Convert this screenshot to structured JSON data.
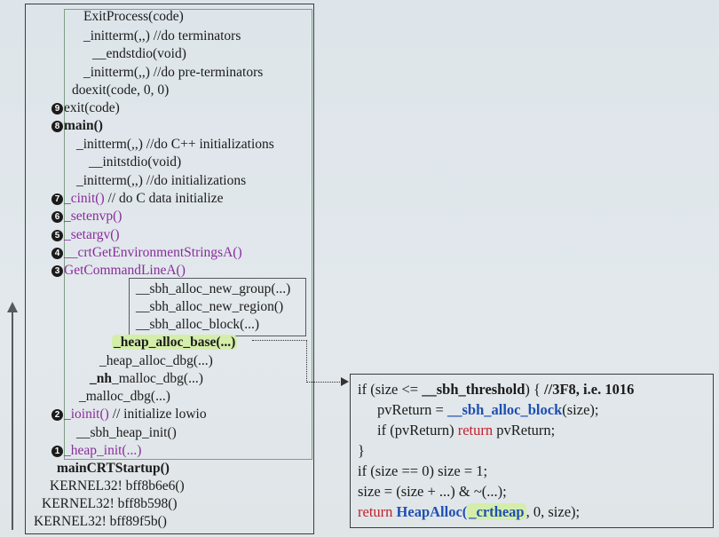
{
  "call_stack": {
    "exit_process": "ExitProcess(code)",
    "initterm_terminators": "_initterm(,,)   //do terminators",
    "endstdio": "__endstdio(void)",
    "initterm_preterminators": "_initterm(,,)   //do pre-terminators",
    "doexit": "doexit(code, 0, 0)",
    "exit": "exit(code)",
    "main": "main()",
    "initterm_cpp": "_initterm(,,)   //do C++ initializations",
    "initstdio": "__initstdio(void)",
    "initterm_init": "_initterm(,,)   //do initializations",
    "cinit_fn": "_cinit()",
    "cinit_comment": "// do C data initialize",
    "setenvp": "_setenvp()",
    "setargv": "_setargv()",
    "crt_get_env": "__crtGetEnvironmentStringsA()",
    "get_cmdline": "GetCommandLineA()",
    "sbh_new_group": "__sbh_alloc_new_group(...)",
    "sbh_new_region": "__sbh_alloc_new_region()",
    "sbh_alloc_block": "__sbh_alloc_block(...)",
    "heap_alloc_base": "_heap_alloc_base(...)",
    "heap_alloc_dbg": "_heap_alloc_dbg(...)",
    "nh_malloc_dbg_prefix": "_nh",
    "nh_malloc_dbg_rest": "_malloc_dbg(...)",
    "malloc_dbg": "_malloc_dbg(...)",
    "ioinit_fn": "_ioinit()",
    "ioinit_comment": "// initialize lowio",
    "sbh_heap_init": "__sbh_heap_init()",
    "heap_init": "_heap_init(...)",
    "main_crt_startup": "mainCRTStartup()",
    "kernel1": "KERNEL32! bff8b6e6()",
    "kernel2": "KERNEL32! bff8b598()",
    "kernel3": "KERNEL32! bff89f5b()"
  },
  "step_numbers": [
    "1",
    "2",
    "3",
    "4",
    "5",
    "6",
    "7",
    "8",
    "9"
  ],
  "code_snippet": {
    "l1_a": "if (size <= ",
    "l1_b": "__sbh_threshold",
    "l1_c": ") {    ",
    "l1_d": "//3F8, i.e. 1016",
    "l2_a": "pvReturn = ",
    "l2_b": "__sbh_alloc_block",
    "l2_c": "(size);",
    "l3_a": "if (pvReturn) ",
    "l3_b": "return",
    "l3_c": " pvReturn;",
    "l4": "}",
    "l5": "if (size == 0)  size = 1;",
    "l6": "size = (size + ...) & ~(...);",
    "l7_a": "return ",
    "l7_b": "HeapAlloc(",
    "l7_c": "_crtheap",
    "l7_d": ", 0, size);"
  },
  "colors": {
    "purple": "#8a2c9c",
    "blue": "#1f4fb2",
    "red": "#c0212c",
    "highlight": "#d4eeaa"
  }
}
